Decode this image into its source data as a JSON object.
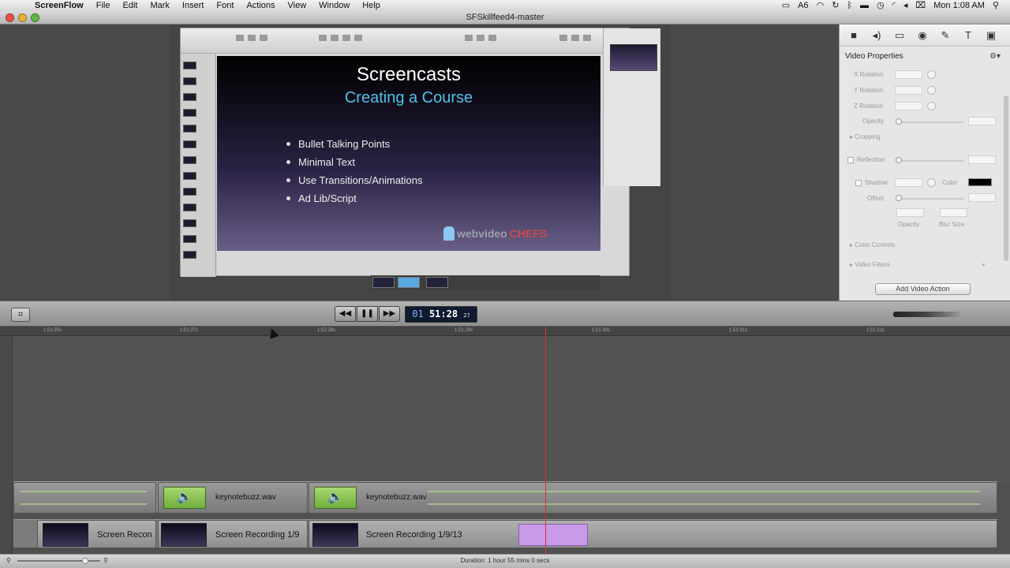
{
  "menubar": {
    "app": "ScreenFlow",
    "items": [
      "File",
      "Edit",
      "Mark",
      "Insert",
      "Font",
      "Actions",
      "View",
      "Window",
      "Help"
    ],
    "status": {
      "adobe": "6",
      "clock": "Mon 1:08 AM"
    }
  },
  "window": {
    "title": "SFSkillfeed4-master"
  },
  "slide": {
    "title": "Screencasts",
    "subtitle": "Creating a Course",
    "bullets": [
      "Bullet Talking Points",
      "Minimal Text",
      "Use Transitions/Animations",
      "Ad Lib/Script"
    ],
    "logo_web": "webvideo",
    "logo_chefs": "CHEFS"
  },
  "properties": {
    "heading": "Video Properties",
    "labels": {
      "x_rotation": "X Rotation",
      "y_rotation": "Y Rotation",
      "z_rotation": "Z Rotation",
      "opacity": "Opacity",
      "cropping": "Cropping",
      "reflection": "Reflection",
      "shadow": "Shadow",
      "color": "Color",
      "offset": "Offset",
      "opacity2": "Opacity",
      "blur_size": "Blur Size",
      "color_controls": "Color Controls",
      "video_filters": "Video Filters"
    },
    "add_button": "Add Video Action",
    "shadow_color": "#000000"
  },
  "transport": {
    "timecode_prefix": "01",
    "timecode_main": "51:28",
    "timecode_frames": "27"
  },
  "timeline": {
    "ruler_ticks": [
      "1:51:25s",
      "1:51:27s",
      "1:51:28s",
      "1:51:29s",
      "1:51:30s",
      "1:51:31s",
      "1:51:32s"
    ],
    "audio_clips": [
      {
        "name": "keynotebuzz.wav"
      },
      {
        "name": "keynotebuzz.wav"
      }
    ],
    "video_clips": [
      {
        "name": "Screen Recon"
      },
      {
        "name": "Screen Recording 1/9"
      },
      {
        "name": "Screen Recording 1/9/13"
      }
    ]
  },
  "status": {
    "duration": "Duration: 1 hour 55 mins 0 secs"
  },
  "colors": {
    "playhead": "#e0303a",
    "accent_subtitle": "#4fc3e8",
    "selected_clip": "#c89ae8"
  }
}
